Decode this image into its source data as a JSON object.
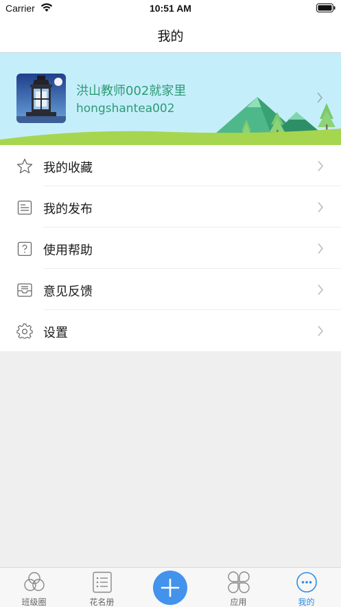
{
  "status_bar": {
    "carrier": "Carrier",
    "time": "10:51 AM"
  },
  "nav": {
    "title": "我的"
  },
  "profile": {
    "name": "洪山教师002就家里",
    "username": "hongshantea002"
  },
  "menu": {
    "items": [
      {
        "label": "我的收藏",
        "icon": "star-icon"
      },
      {
        "label": "我的发布",
        "icon": "document-icon"
      },
      {
        "label": "使用帮助",
        "icon": "help-icon"
      },
      {
        "label": "意见反馈",
        "icon": "feedback-inbox-icon"
      },
      {
        "label": "设置",
        "icon": "gear-icon"
      }
    ]
  },
  "tabs": {
    "items": [
      {
        "label": "班级圈",
        "icon": "circles-icon",
        "active": false
      },
      {
        "label": "花名册",
        "icon": "roster-list-icon",
        "active": false
      },
      {
        "label": "",
        "icon": "plus-icon",
        "active": false
      },
      {
        "label": "应用",
        "icon": "apps-clover-icon",
        "active": false
      },
      {
        "label": "我的",
        "icon": "more-dots-icon",
        "active": true
      }
    ]
  },
  "colors": {
    "accent": "#2b8de6",
    "banner_bg": "#c5eefb",
    "profile_text": "#2e9a72",
    "add_button": "#4393ec"
  }
}
